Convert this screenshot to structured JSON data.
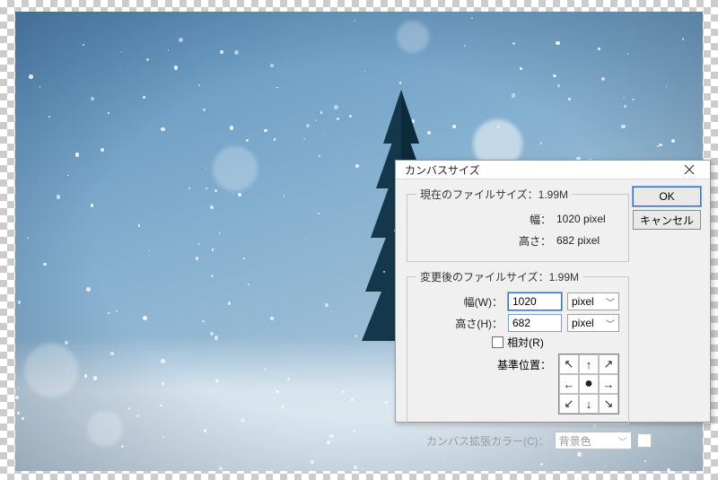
{
  "dialog": {
    "title": "カンバスサイズ",
    "ok_label": "OK",
    "cancel_label": "キャンセル",
    "current_group": {
      "legend": "現在のファイルサイズ：1.99M",
      "width_label": "幅：",
      "width_value": "1020 pixel",
      "height_label": "高さ：",
      "height_value": "682 pixel"
    },
    "new_group": {
      "legend": "変更後のファイルサイズ：1.99M",
      "width_label": "幅(W)：",
      "width_value": "1020",
      "width_unit": "pixel",
      "height_label": "高さ(H)：",
      "height_value": "682",
      "height_unit": "pixel",
      "relative_label": "相対(R)",
      "anchor_label": "基準位置：",
      "arrows": [
        "↖",
        "↑",
        "↗",
        "←",
        "●",
        "→",
        "↙",
        "↓",
        "↘"
      ]
    },
    "extension": {
      "label": "カンバス拡張カラー(C)：",
      "value": "背景色"
    }
  }
}
